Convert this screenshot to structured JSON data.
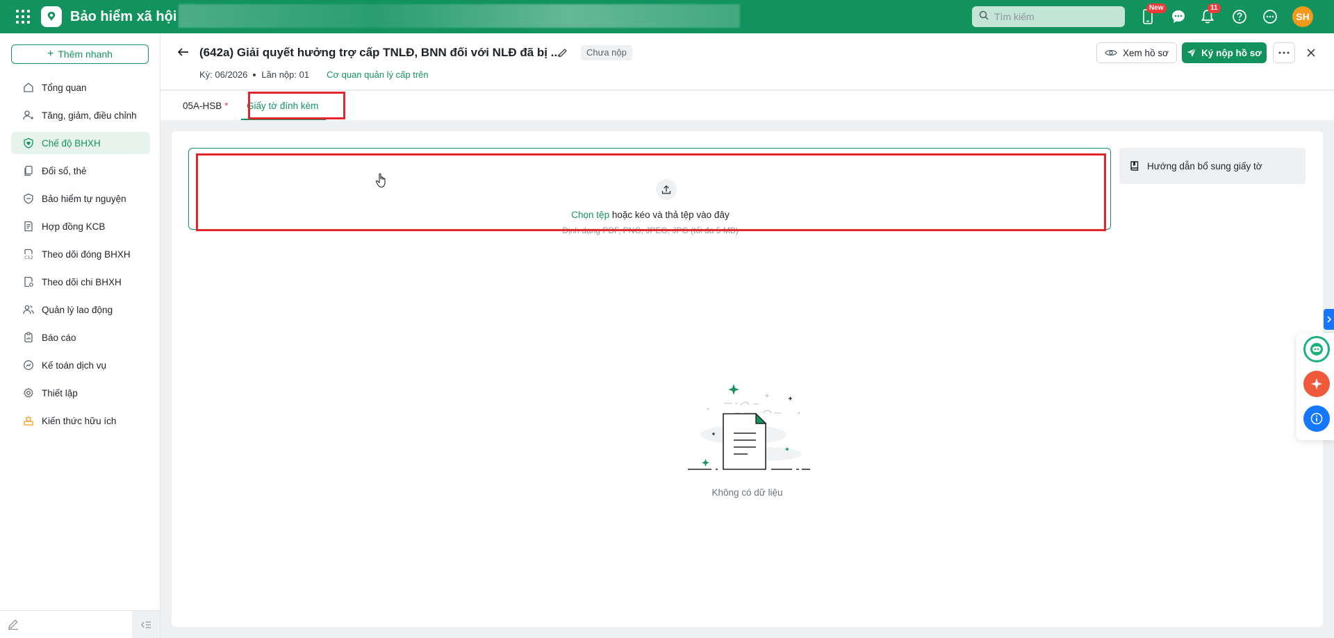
{
  "topbar": {
    "brand": "Bảo hiểm xã hội",
    "search_placeholder": "Tìm kiếm",
    "new_badge": "New",
    "notifications_count": "11",
    "avatar_initials": "SH",
    "colors": {
      "brand": "#12935e",
      "badge": "#f13a3a",
      "avatar": "#f39a1c"
    }
  },
  "sidebar": {
    "quick_add_label": "Thêm nhanh",
    "items": [
      {
        "label": "Tổng quan",
        "icon": "home-icon"
      },
      {
        "label": "Tăng, giảm, điều chỉnh",
        "icon": "user-adjust-icon"
      },
      {
        "label": "Chế độ BHXH",
        "icon": "shield-heart-icon",
        "active": true
      },
      {
        "label": "Đổi sổ, thẻ",
        "icon": "copy-card-icon"
      },
      {
        "label": "Bảo hiểm tự nguyện",
        "icon": "shield-icon"
      },
      {
        "label": "Hợp đồng KCB",
        "icon": "contract-icon"
      },
      {
        "label": "Theo dõi đóng BHXH",
        "icon": "c12-document-icon"
      },
      {
        "label": "Theo dõi chi BHXH",
        "icon": "document-settings-icon"
      },
      {
        "label": "Quản lý lao động",
        "icon": "users-icon"
      },
      {
        "label": "Báo cáo",
        "icon": "report-icon"
      },
      {
        "label": "Kế toán dịch vụ",
        "icon": "accounting-icon"
      },
      {
        "label": "Thiết lập",
        "icon": "gear-icon"
      },
      {
        "label": "Kiến thức hữu ích",
        "icon": "knowledge-icon"
      }
    ]
  },
  "header": {
    "title": "(642a) Giải quyết hưởng trợ cấp TNLĐ, BNN đối với NLĐ đã bị ...",
    "status": "Chưa nộp",
    "period": "Kỳ: 06/2026",
    "submission": "Lần nộp: 01",
    "agency_link": "Cơ quan quản lý cấp trên",
    "view_button": "Xem hồ sơ",
    "sign_button": "Ký nộp hồ sơ"
  },
  "tabs": [
    {
      "label": "05A-HSB",
      "required_mark": "*"
    },
    {
      "label": "Giấy tờ đính kèm",
      "active": true
    }
  ],
  "upload": {
    "choose_file": "Chọn tệp",
    "drag_text": " hoặc kéo và thả tệp vào đây",
    "format_hint": "Định dạng PDF, PNG, JPEG, JPG (tối đa 5 MB)"
  },
  "guide_button": "Hướng dẫn bổ sung giấy tờ",
  "empty_state": "Không có dữ liệu"
}
